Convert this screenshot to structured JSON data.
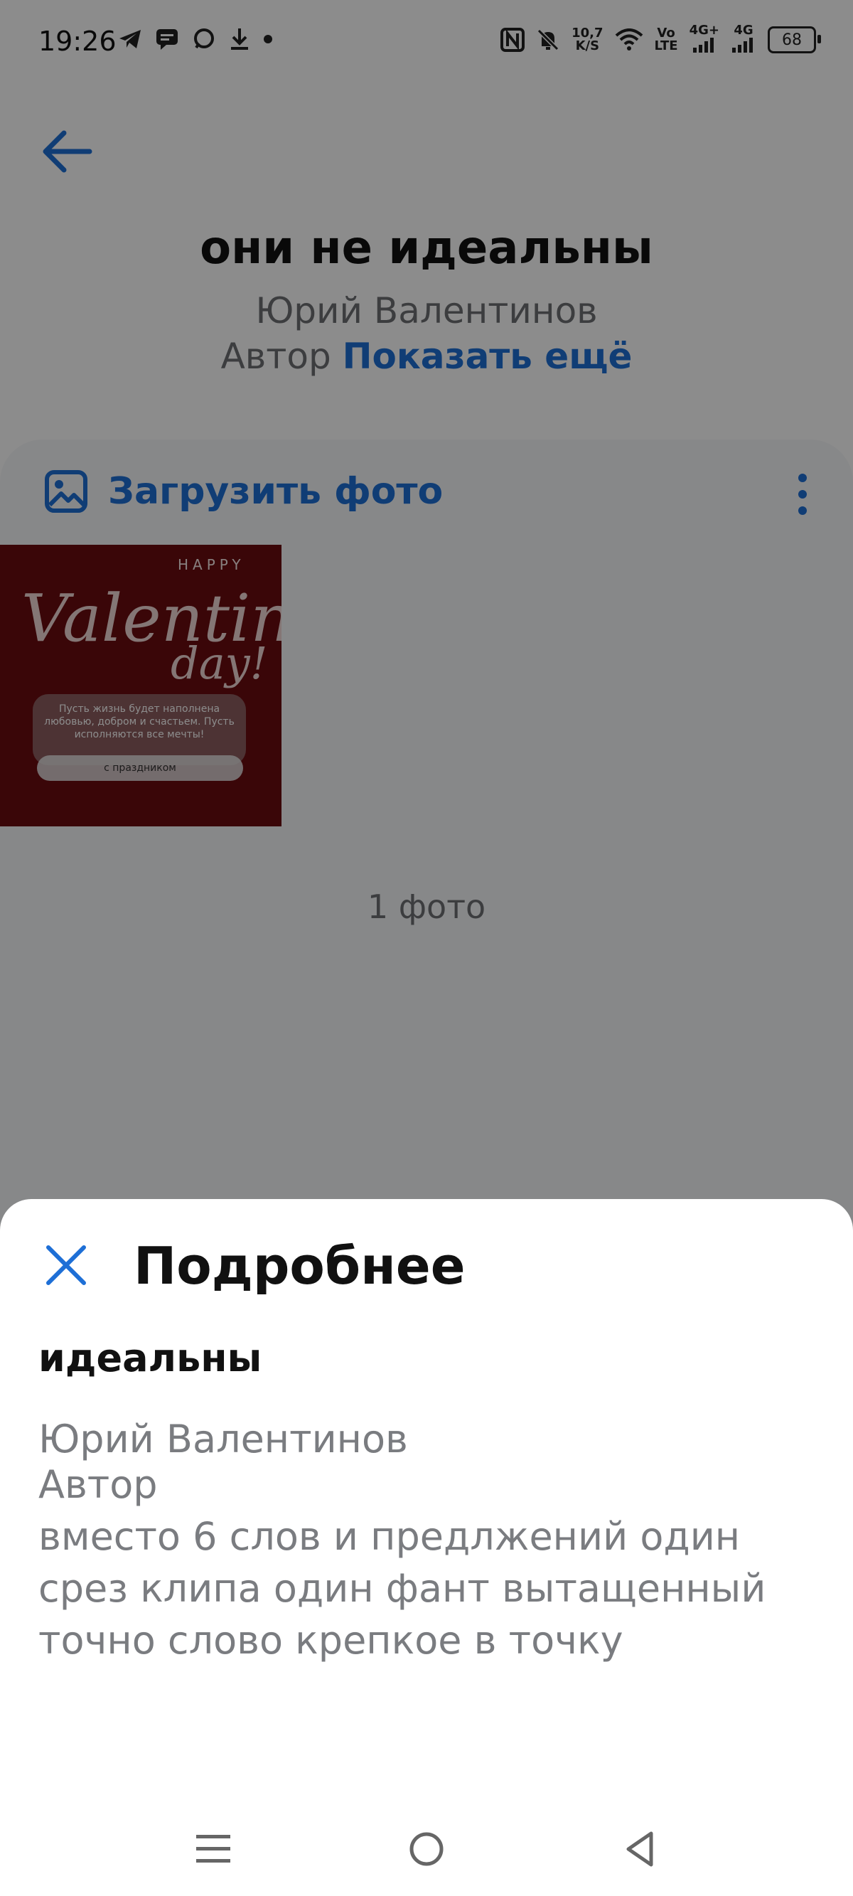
{
  "status_bar": {
    "time": "19:26",
    "net_speed_value": "10,7",
    "net_speed_unit": "K/S",
    "volte_top": "Vo",
    "volte_bottom": "LTE",
    "signal1": "4G+",
    "signal2": "4G",
    "battery": "68"
  },
  "header": {
    "title": "они не идеальны",
    "author_name": "Юрий Валентинов",
    "author_role": "Автор",
    "show_more": "Показать ещё"
  },
  "album": {
    "upload_label": "Загрузить фото",
    "count": "1 фото",
    "photo": {
      "happy": "HAPPY",
      "line1": "Valentines",
      "line2": "day!",
      "message": "Пусть жизнь будет наполнена любовью, добром и счастьем. Пусть исполняются все мечты!",
      "button": "с праздником"
    }
  },
  "sheet": {
    "title": "Подробнее",
    "subtitle": "идеальны",
    "author_name": "Юрий Валентинов",
    "author_role": "Автор",
    "description": "вместо 6 слов и предлжений один срез клипа один фант вытащенный точно слово крепкое в точку"
  },
  "colors": {
    "accent": "#1e6fd6",
    "overlay": "rgba(0,0,0,0.45)"
  }
}
